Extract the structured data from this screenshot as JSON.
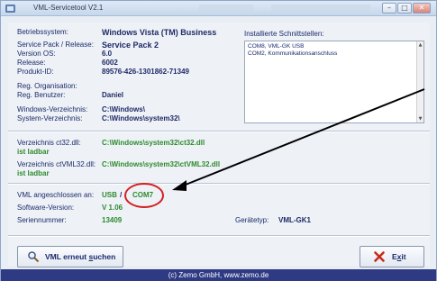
{
  "window": {
    "title": "VML-Servicetool V2.1",
    "controls": {
      "minimize": "–",
      "maximize": "□",
      "close": "✕"
    }
  },
  "system": {
    "os_label": "Betriebssystem:",
    "os_value": "Windows Vista (TM) Business",
    "sp_label": "Service Pack / Release:",
    "sp_value": "Service Pack 2",
    "version_label": "Version OS:",
    "version_value": "6.0",
    "release_label": "Release:",
    "release_value": "6002",
    "product_label": "Produkt-ID:",
    "product_value": "89576-426-1301862-71349",
    "org_label": "Reg. Organisation:",
    "org_value": "",
    "user_label": "Reg. Benutzer:",
    "user_value": "Daniel",
    "windir_label": "Windows-Verzeichnis:",
    "windir_value": "C:\\Windows\\",
    "sysdir_label": "System-Verzeichnis:",
    "sysdir_value": "C:\\Windows\\system32\\"
  },
  "interfaces": {
    "label": "Installierte Schnittstellen:",
    "items": [
      "COM8, VML-GK USB",
      "COM2, Kommunikationsanschluss"
    ]
  },
  "dlls": {
    "ct32_label": "Verzeichnis ct32.dll:",
    "ct32_status": "ist ladbar",
    "ct32_path": "C:\\Windows\\system32\\ct32.dll",
    "ctvml_label": "Verzeichnis ctVML32.dll:",
    "ctvml_status": "ist ladbar",
    "ctvml_path": "C:\\Windows\\system32\\ctVML32.dll"
  },
  "vml": {
    "conn_label": "VML angeschlossen an:",
    "conn_usb": "USB",
    "conn_sep": "/",
    "conn_port": "COM7",
    "sw_label": "Software-Version:",
    "sw_value": "V 1.06",
    "serial_label": "Seriennummer:",
    "serial_value": "13409",
    "type_label": "Gerätetyp:",
    "type_value": "VML-GK1"
  },
  "buttons": {
    "search_pre": "VML erneut ",
    "search_u": "s",
    "search_post": "uchen",
    "exit_pre": "E",
    "exit_u": "x",
    "exit_post": "it"
  },
  "footer": {
    "text": "(c) Zemo GmbH, www.zemo.de"
  },
  "annotation": {
    "highlight_color": "#d42020",
    "arrow_color": "#000000"
  }
}
